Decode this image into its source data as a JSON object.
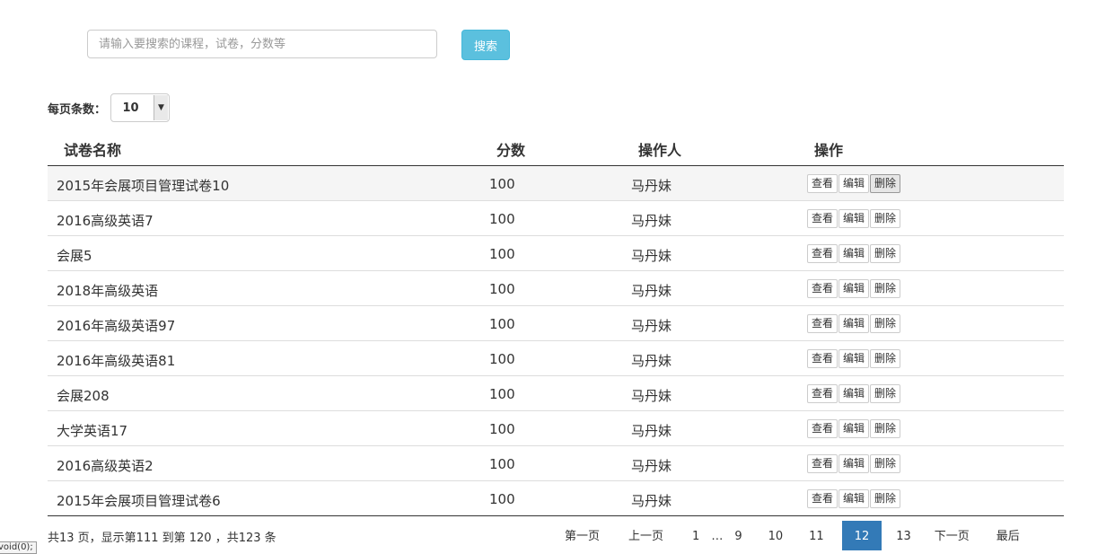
{
  "search": {
    "placeholder": "请输入要搜索的课程，试卷，分数等",
    "value": "",
    "button_label": "搜索"
  },
  "page_size": {
    "label": "每页条数：",
    "value": "10"
  },
  "table": {
    "columns": [
      "试卷名称",
      "分数",
      "操作人",
      "操作"
    ],
    "actions": {
      "view": "查看",
      "edit": "编辑",
      "delete": "删除"
    },
    "rows": [
      {
        "name": "2015年会展项目管理试卷10",
        "score": "100",
        "operator": "马丹妹"
      },
      {
        "name": "2016高级英语7",
        "score": "100",
        "operator": "马丹妹"
      },
      {
        "name": "会展5",
        "score": "100",
        "operator": "马丹妹"
      },
      {
        "name": "2018年高级英语",
        "score": "100",
        "operator": "马丹妹"
      },
      {
        "name": "2016年高级英语97",
        "score": "100",
        "operator": "马丹妹"
      },
      {
        "name": "2016年高级英语81",
        "score": "100",
        "operator": "马丹妹"
      },
      {
        "name": "会展208",
        "score": "100",
        "operator": "马丹妹"
      },
      {
        "name": "大学英语17",
        "score": "100",
        "operator": "马丹妹"
      },
      {
        "name": "2016高级英语2",
        "score": "100",
        "operator": "马丹妹"
      },
      {
        "name": "2015年会展项目管理试卷6",
        "score": "100",
        "operator": "马丹妹"
      }
    ]
  },
  "pagination": {
    "summary": "共13 页，显示第111 到第 120 ，共123 条",
    "first": "第一页",
    "prev": "上一页",
    "pages": [
      "1",
      "…",
      "9",
      "10",
      "11",
      "12",
      "13"
    ],
    "active_page": "12",
    "next": "下一页",
    "last": "最后"
  },
  "status_tip": "void(0);"
}
